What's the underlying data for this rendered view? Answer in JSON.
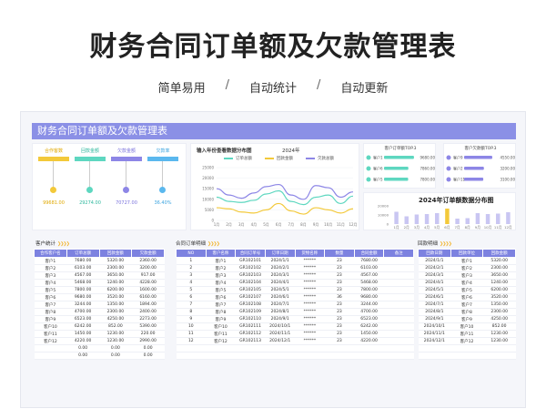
{
  "hero": {
    "title": "财务合同订单额及欠款管理表",
    "subtitle": [
      "简单易用",
      "自动统计",
      "自动更新"
    ],
    "sep": "/"
  },
  "sheet_title": "财务合同订单额及欠款管理表",
  "kpi": {
    "items": [
      {
        "label": "合作客数",
        "value": "99681.00",
        "color": "#f3c93a"
      },
      {
        "label": "回款金额",
        "value": "29274.00",
        "color": "#5ed7c0"
      },
      {
        "label": "欠款金额",
        "value": "70727.00",
        "color": "#8d86e6"
      },
      {
        "label": "欠款率",
        "value": "36.40%",
        "color": "#5bb8ee"
      }
    ]
  },
  "line_chart_title": "输入年份查看数据分布图",
  "line_chart_year": "2024年",
  "top_customers": {
    "title": "客户订单额TOP.3",
    "rows": [
      {
        "name": "客户1",
        "value": "9680.00"
      },
      {
        "name": "客户6",
        "value": "7860.00"
      },
      {
        "name": "客户5",
        "value": "7800.00"
      }
    ]
  },
  "top_debt": {
    "title": "客户欠款额TOP.3",
    "rows": [
      {
        "name": "客户9",
        "value": "4550.00"
      },
      {
        "name": "客户2",
        "value": "3200.00"
      },
      {
        "name": "客户11",
        "value": "3100.00"
      }
    ]
  },
  "dist_title": "2024年订单额数据分布图",
  "chart_data": [
    {
      "type": "line",
      "x": [
        "1月",
        "2月",
        "3月",
        "4月",
        "5月",
        "6月",
        "7月",
        "8月",
        "9月",
        "10月",
        "11月",
        "12月"
      ],
      "ylim": [
        0,
        25000
      ],
      "yticks": [
        "25000",
        "20000",
        "15000",
        "10000",
        "5000",
        "0"
      ],
      "series": [
        {
          "name": "订单总额",
          "color": "#5ed7c0",
          "values": [
            11000,
            9000,
            8500,
            9500,
            12500,
            14000,
            9000,
            7500,
            11000,
            12000,
            8000,
            11500
          ]
        },
        {
          "name": "回款金额",
          "color": "#f3c93a",
          "values": [
            6000,
            5500,
            4000,
            3500,
            5000,
            8000,
            4500,
            3000,
            6000,
            5000,
            3500,
            5500
          ]
        },
        {
          "name": "欠款总额",
          "color": "#8d86e6",
          "values": [
            15000,
            12000,
            10500,
            13000,
            16000,
            17000,
            12000,
            10000,
            16500,
            15500,
            11000,
            13500
          ]
        }
      ]
    },
    {
      "type": "bar",
      "categories": [
        "1月",
        "2月",
        "3月",
        "4月",
        "5月",
        "6月",
        "7月",
        "8月",
        "9月",
        "10月",
        "11月",
        "12月"
      ],
      "ylim": [
        0,
        20000
      ],
      "yticks": [
        "20000",
        "10000",
        "0"
      ],
      "values": [
        13500,
        8500,
        10500,
        11000,
        12000,
        17000,
        6000,
        6500,
        12000,
        11000,
        11500,
        13000
      ],
      "highlight_index": 5
    }
  ],
  "customer_stats": {
    "title": "客户统计",
    "columns": [
      "合作客户名",
      "订单总额",
      "回款金额",
      "欠款金额"
    ],
    "rows": [
      [
        "客户1",
        "7680.00",
        "5320.00",
        "2360.00"
      ],
      [
        "客户2",
        "6103.00",
        "2300.00",
        "3200.00"
      ],
      [
        "客户3",
        "4567.00",
        "3650.00",
        "917.00"
      ],
      [
        "客户4",
        "5468.00",
        "1240.00",
        "4228.00"
      ],
      [
        "客户5",
        "7800.00",
        "6200.00",
        "1600.00"
      ],
      [
        "客户6",
        "9680.00",
        "3520.00",
        "6160.00"
      ],
      [
        "客户7",
        "3244.00",
        "1350.00",
        "1894.00"
      ],
      [
        "客户8",
        "4700.00",
        "2300.00",
        "2400.00"
      ],
      [
        "客户9",
        "6523.00",
        "4250.00",
        "2273.00"
      ],
      [
        "客户10",
        "6242.00",
        "852.00",
        "5390.00"
      ],
      [
        "客户11",
        "1450.00",
        "1230.00",
        "220.00"
      ],
      [
        "客户12",
        "4220.00",
        "1230.00",
        "2990.00"
      ],
      [
        "",
        "0.00",
        "0.00",
        "0.00"
      ],
      [
        "",
        "0.00",
        "0.00",
        "0.00"
      ]
    ]
  },
  "orders": {
    "title": "合同订单明细",
    "columns": [
      "NO",
      "客户名称",
      "合同订单号",
      "订单日期",
      "货物名称",
      "数量",
      "合同金额",
      "备注"
    ],
    "rows": [
      [
        "1",
        "客户1",
        "GR102101",
        "2024/1/1",
        "******",
        "23",
        "7680.00",
        ""
      ],
      [
        "2",
        "客户2",
        "GR102102",
        "2024/2/1",
        "******",
        "23",
        "6103.00",
        ""
      ],
      [
        "3",
        "客户3",
        "GR102103",
        "2024/3/1",
        "******",
        "23",
        "4567.00",
        ""
      ],
      [
        "4",
        "客户4",
        "GR102104",
        "2024/4/1",
        "******",
        "23",
        "5468.00",
        ""
      ],
      [
        "5",
        "客户5",
        "GR102105",
        "2024/5/1",
        "******",
        "23",
        "7800.00",
        ""
      ],
      [
        "6",
        "客户6",
        "GR102107",
        "2024/6/1",
        "******",
        "36",
        "9680.00",
        ""
      ],
      [
        "7",
        "客户7",
        "GR102108",
        "2024/7/1",
        "******",
        "23",
        "3244.00",
        ""
      ],
      [
        "8",
        "客户8",
        "GR102109",
        "2024/8/1",
        "******",
        "23",
        "4700.00",
        ""
      ],
      [
        "9",
        "客户9",
        "GR102110",
        "2024/9/1",
        "******",
        "23",
        "6523.00",
        ""
      ],
      [
        "10",
        "客户10",
        "GR102111",
        "2024/10/1",
        "******",
        "23",
        "6242.00",
        ""
      ],
      [
        "11",
        "客户11",
        "GR102112",
        "2024/11/1",
        "******",
        "23",
        "1450.00",
        ""
      ],
      [
        "12",
        "客户12",
        "GR102113",
        "2024/12/1",
        "******",
        "23",
        "4220.00",
        ""
      ],
      [
        "",
        "",
        "",
        "",
        "",
        "",
        "",
        ""
      ],
      [
        "",
        "",
        "",
        "",
        "",
        "",
        "",
        ""
      ]
    ]
  },
  "payments": {
    "title": "回款明细",
    "columns": [
      "回款日期",
      "回款单位",
      "回款金额"
    ],
    "rows": [
      [
        "2024/1/1",
        "客户1",
        "5320.00"
      ],
      [
        "2024/2/1",
        "客户2",
        "2300.00"
      ],
      [
        "2024/3/1",
        "客户3",
        "3650.00"
      ],
      [
        "2024/4/1",
        "客户4",
        "1240.00"
      ],
      [
        "2024/5/1",
        "客户5",
        "6200.00"
      ],
      [
        "2024/6/1",
        "客户6",
        "3520.00"
      ],
      [
        "2024/7/1",
        "客户7",
        "1350.00"
      ],
      [
        "2024/8/1",
        "客户8",
        "2300.00"
      ],
      [
        "2024/9/1",
        "客户9",
        "4250.00"
      ],
      [
        "2024/10/1",
        "客户10",
        "852.00"
      ],
      [
        "2024/11/1",
        "客户11",
        "1230.00"
      ],
      [
        "2024/12/1",
        "客户12",
        "1230.00"
      ],
      [
        "",
        "",
        ""
      ],
      [
        "",
        "",
        ""
      ]
    ]
  }
}
